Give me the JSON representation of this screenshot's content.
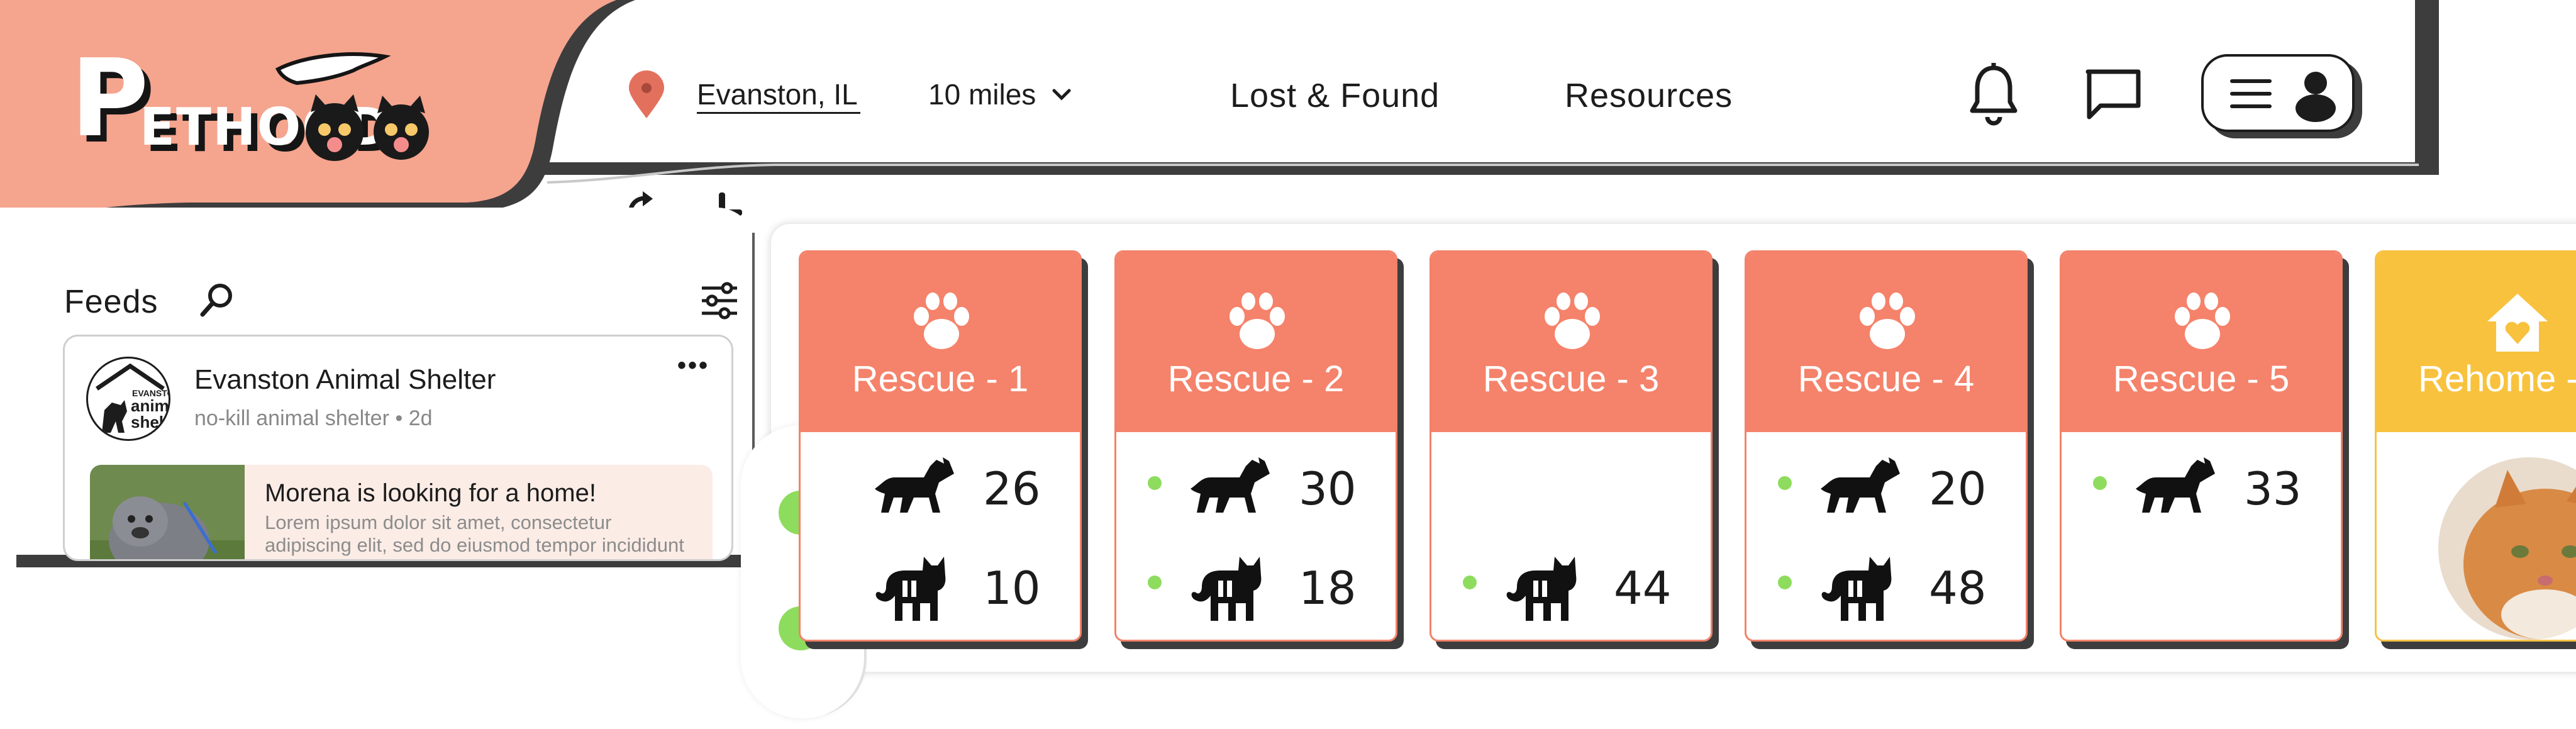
{
  "app": {
    "brand_primary": "#F5A48E",
    "rescue_color": "#F5826A",
    "rehome_color": "#F8C23E",
    "status_dot_color": "#8EDC5E"
  },
  "logo": {
    "text_big": "P",
    "text_rest": "ETHOOD"
  },
  "header": {
    "location": "Evanston, IL",
    "distance": "10 miles",
    "nav": [
      "Lost & Found",
      "Resources"
    ]
  },
  "feeds": {
    "title": "Feeds",
    "post": {
      "avatar_text": [
        "EVANSTON",
        "animal",
        "shelter"
      ],
      "name": "Evanston Animal Shelter",
      "subtitle": "no-kill animal shelter • 2d",
      "more": "•••",
      "headline": "Morena is looking for a home!",
      "body": "Lorem ipsum dolor sit amet, consectetur adipiscing elit, sed do eiusmod tempor incididunt"
    }
  },
  "cards": [
    {
      "title": "Rescue - 1",
      "kind": "rescue",
      "dogs": "26",
      "cats": "10",
      "dog_dot": false,
      "cat_dot": false
    },
    {
      "title": "Rescue - 2",
      "kind": "rescue",
      "dogs": "30",
      "cats": "18",
      "dog_dot": true,
      "cat_dot": true
    },
    {
      "title": "Rescue - 3",
      "kind": "rescue",
      "dogs": null,
      "cats": "44",
      "dog_dot": false,
      "cat_dot": true
    },
    {
      "title": "Rescue - 4",
      "kind": "rescue",
      "dogs": "20",
      "cats": "48",
      "dog_dot": true,
      "cat_dot": true
    },
    {
      "title": "Rescue - 5",
      "kind": "rescue",
      "dogs": "33",
      "cats": null,
      "dog_dot": true,
      "cat_dot": false
    },
    {
      "title": "Rehome -",
      "kind": "rehome"
    }
  ]
}
